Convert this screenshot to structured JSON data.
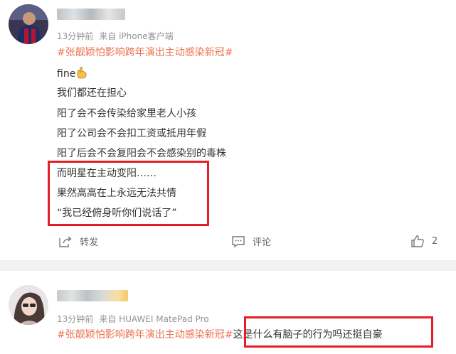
{
  "post1": {
    "meta": {
      "time": "13分钟前",
      "source": "来自 iPhone客户端"
    },
    "topic": "#张靓颖怕影响跨年演出主动感染新冠#",
    "lines": [
      "fine",
      "我们都还在担心",
      "阳了会不会传染给家里老人小孩",
      "阳了公司会不会扣工资或抵用年假",
      "阳了后会不会复阳会不会感染别的毒株",
      "而明星在主动变阳……",
      "果然高高在上永远无法共情",
      "“我已经俯身听你们说话了”"
    ],
    "actions": {
      "repost": "转发",
      "comment": "评论",
      "like_count": "2"
    }
  },
  "post2": {
    "meta": {
      "time": "13分钟前",
      "source": "来自 HUAWEI MatePad Pro"
    },
    "topic": "#张靓颖怕影响跨年演出主动感染新冠#",
    "text": "这是什么有脑子的行为吗还挺自豪"
  },
  "colors": {
    "topic": "#eb7350",
    "highlight_box": "#e51d24",
    "meta": "#939393",
    "separator": "#f2f2f2"
  },
  "icons": [
    "finger-emoji-icon",
    "repost-icon",
    "comment-icon",
    "like-icon"
  ]
}
